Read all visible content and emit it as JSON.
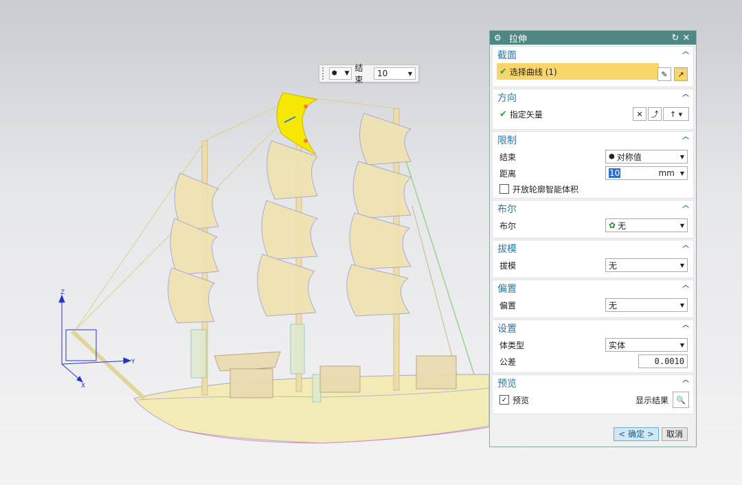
{
  "mini_toolbar": {
    "end_label": "结束",
    "end_value": "10"
  },
  "dialog": {
    "title": "拉伸",
    "sections": {
      "section": {
        "title": "截面",
        "select_curve": "选择曲线 (1)"
      },
      "direction": {
        "title": "方向",
        "specify_vector": "指定矢量"
      },
      "limits": {
        "title": "限制",
        "end_label": "结束",
        "end_value": "对称值",
        "distance_label": "距离",
        "distance_value": "10",
        "distance_unit": "mm",
        "open_profile_label": "开放轮廓智能体积"
      },
      "boolean": {
        "title": "布尔",
        "label": "布尔",
        "value": "无"
      },
      "draft": {
        "title": "拔模",
        "label": "拔模",
        "value": "无"
      },
      "offset": {
        "title": "偏置",
        "label": "偏置",
        "value": "无"
      },
      "settings": {
        "title": "设置",
        "body_type_label": "体类型",
        "body_type_value": "实体",
        "tolerance_label": "公差",
        "tolerance_value": "0.0010"
      },
      "preview": {
        "title": "预览",
        "preview_label": "预览",
        "show_result_label": "显示结果"
      }
    },
    "buttons": {
      "ok": "< 确定 >",
      "cancel": "取消"
    }
  },
  "axes": {
    "z": "Z",
    "y": "Y",
    "x": "X"
  },
  "colors": {
    "title_bar": "#4e8783",
    "section_title": "#2f78a6",
    "highlight_row": "#f8d66b",
    "sail_fill": "#f1e6b9",
    "selected_sail": "#f6e800"
  }
}
